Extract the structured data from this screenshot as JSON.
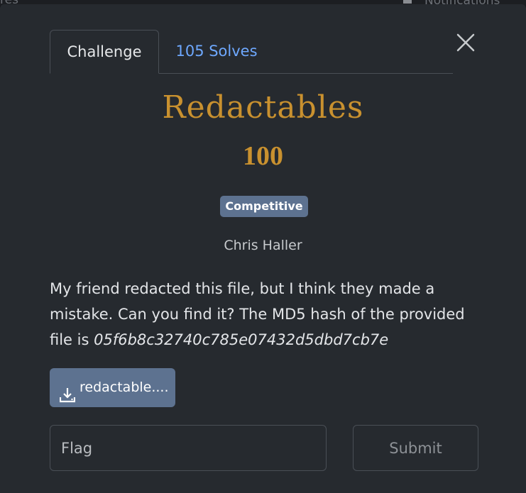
{
  "background": {
    "left_text": "res",
    "right_text": "Notifications"
  },
  "tabs": [
    {
      "label": "Challenge",
      "active": true
    },
    {
      "label": "105 Solves",
      "active": false
    }
  ],
  "challenge": {
    "name": "Redactables",
    "points": "100",
    "category_badge": "Competitive",
    "author": "Chris Haller",
    "description_text": "My friend redacted this file, but I think they made a mistake. Can you find it? The MD5 hash of the provided file is ",
    "description_hash": "05f6b8c32740c785e07432d5dbd7cb7e",
    "file_button_label": "redactable...."
  },
  "flag_form": {
    "placeholder": "Flag",
    "value": "",
    "submit_label": "Submit"
  },
  "colors": {
    "accent_gold": "#c9912f",
    "badge_blue": "#5d7290",
    "link_blue": "#6ea8fe",
    "modal_bg": "#262a2f"
  },
  "icons": {
    "close": "close-icon",
    "download": "download-icon"
  }
}
